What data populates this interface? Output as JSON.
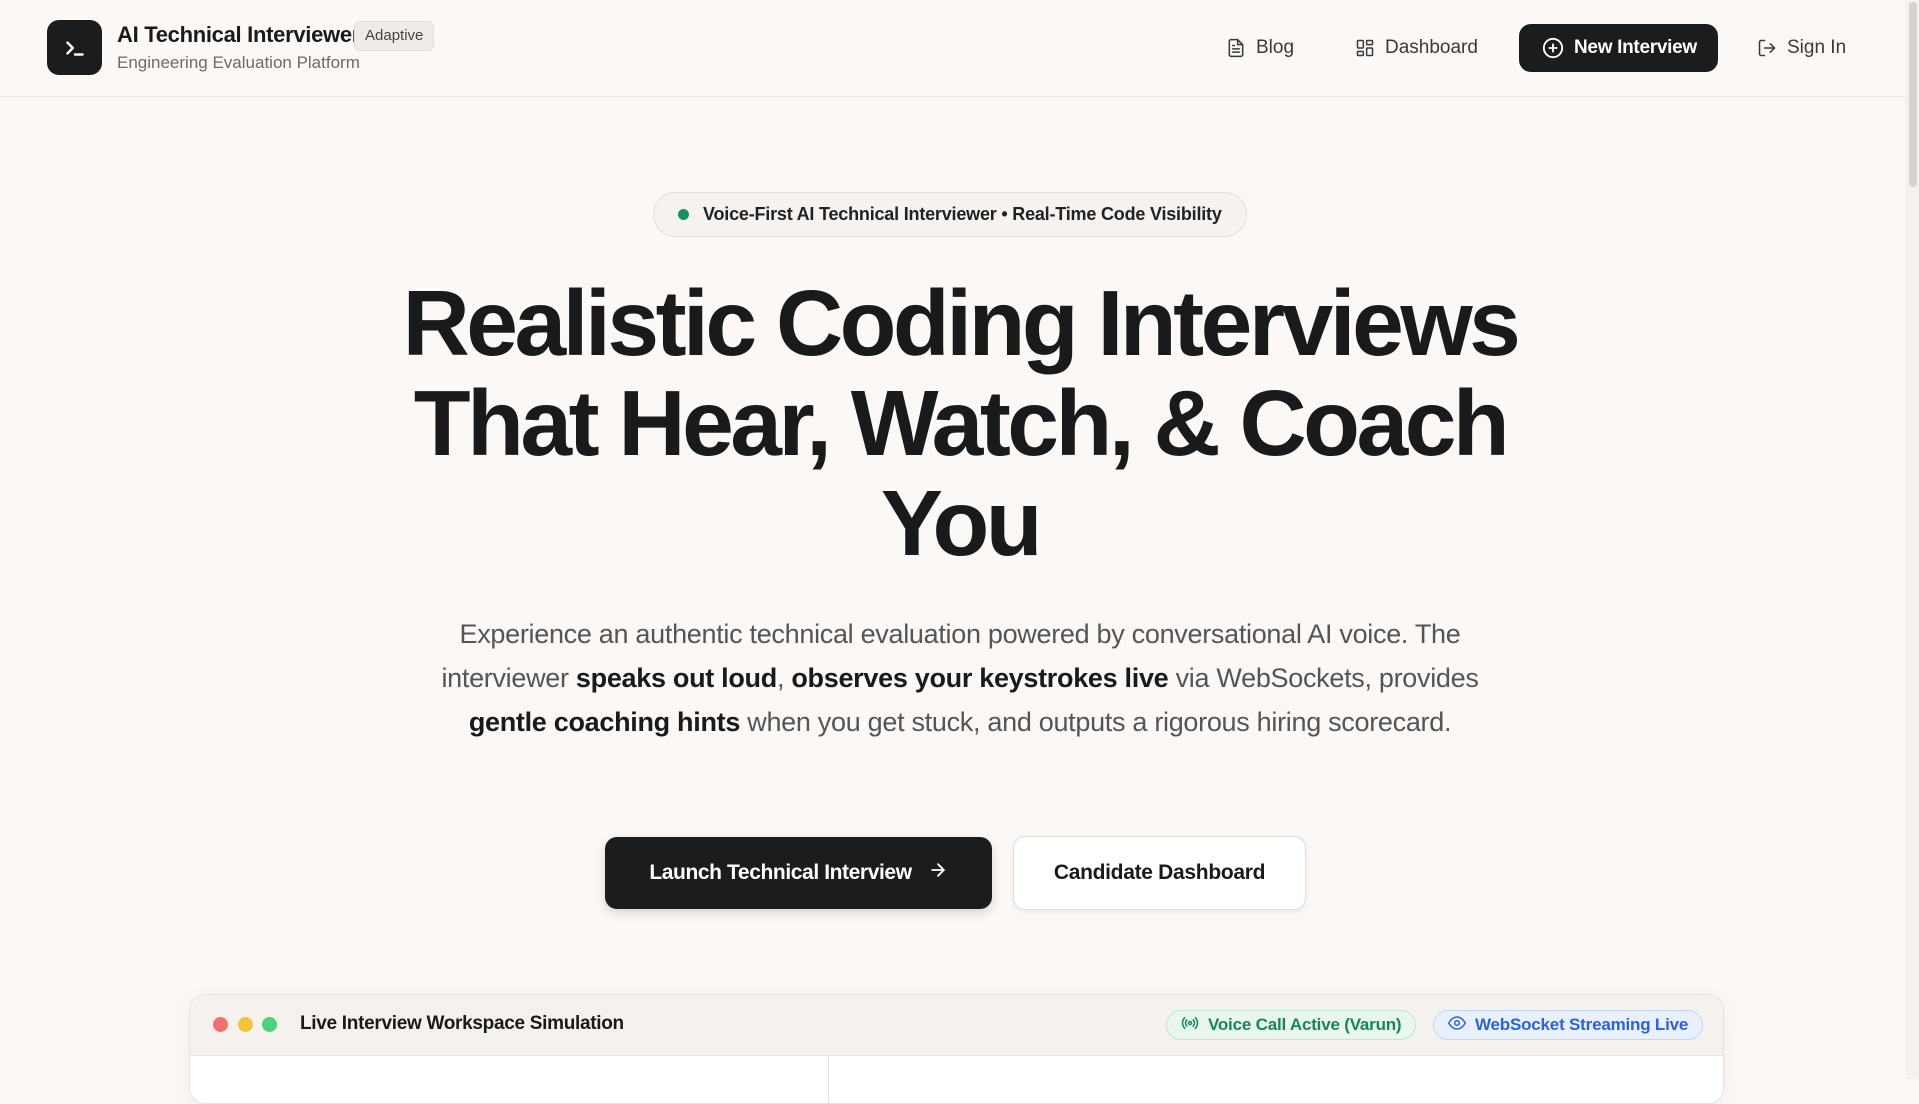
{
  "header": {
    "brand_title": "AI Technical Interviewer",
    "brand_badge": "Adaptive",
    "brand_subtitle": "Engineering Evaluation Platform",
    "nav": {
      "blog": "Blog",
      "dashboard": "Dashboard",
      "new_interview": "New Interview",
      "sign_in": "Sign In"
    }
  },
  "hero": {
    "pill_text": "Voice-First AI Technical Interviewer • Real-Time Code Visibility",
    "title_line_1": "Realistic Coding Interviews",
    "title_line_2": "That Hear, Watch, & Coach",
    "title_line_3": "You",
    "description": {
      "p1": "Experience an authentic technical evaluation powered by conversational AI voice. The interviewer ",
      "b1": "speaks out loud",
      "p2": ", ",
      "b2": "observes your keystrokes live",
      "p3": " via WebSockets, provides ",
      "b3": "gentle coaching hints",
      "p4": " when you get stuck, and outputs a rigorous hiring scorecard."
    },
    "primary_cta": "Launch Technical Interview",
    "secondary_cta": "Candidate Dashboard"
  },
  "workspace": {
    "title": "Live Interview Workspace Simulation",
    "voice_badge": "Voice Call Active (Varun)",
    "socket_badge": "WebSocket Streaming Live"
  },
  "colors": {
    "accent_dark": "#1c1c1c",
    "status_green": "#16915f",
    "status_blue": "#2b63d9",
    "background": "#fbf8f6"
  },
  "icons": {
    "logo": "terminal-icon",
    "blog": "document-icon",
    "dashboard": "grid-icon",
    "new_interview": "plus-circle-icon",
    "sign_in": "log-out-icon",
    "primary_cta": "arrow-right-icon",
    "voice_badge": "radio-signal-icon",
    "socket_badge": "eye-icon"
  }
}
